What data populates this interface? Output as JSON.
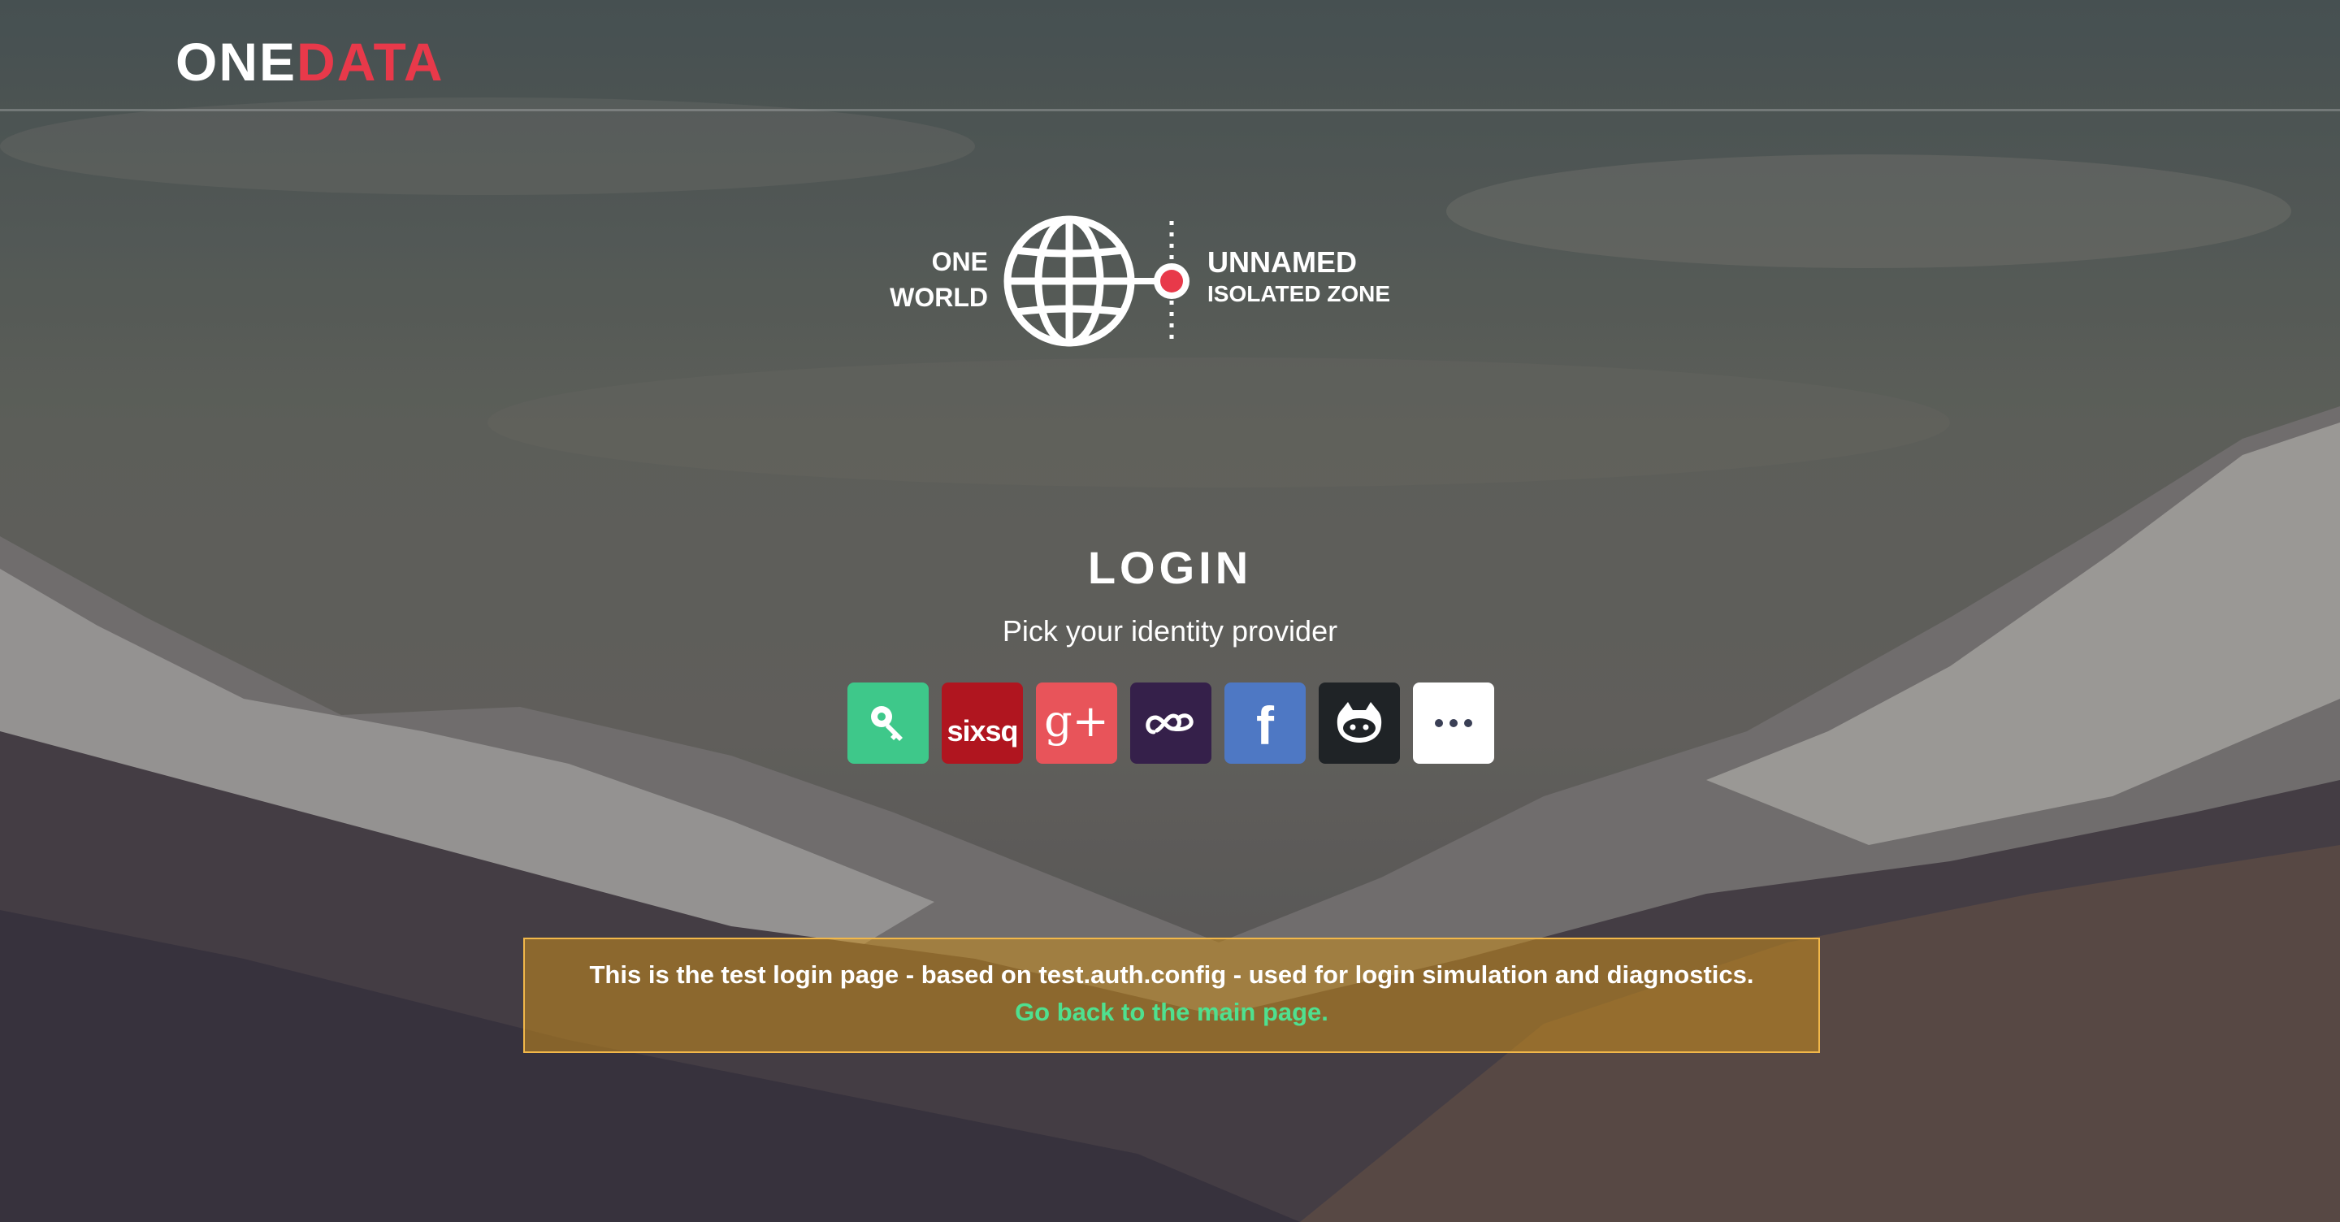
{
  "brand": {
    "prefix": "ONE",
    "accent": "DATA"
  },
  "emblem": {
    "left_line1": "ONE",
    "left_line2": "WORLD",
    "zone_name": "UNNAMED",
    "zone_type": "ISOLATED ZONE"
  },
  "login": {
    "title": "LOGIN",
    "subtitle": "Pick your identity provider"
  },
  "providers": [
    {
      "name": "basic-auth",
      "icon": "key-icon",
      "color": "#3ec88a"
    },
    {
      "name": "sixsq",
      "label": "sixsq",
      "color": "#b0151f"
    },
    {
      "name": "google",
      "label": "g+",
      "color": "#e8545a"
    },
    {
      "name": "elixir",
      "icon": "infinity-cloud-icon",
      "color": "#35204a"
    },
    {
      "name": "facebook",
      "label": "f",
      "color": "#4e78c4"
    },
    {
      "name": "github",
      "icon": "github-octocat-icon",
      "color": "#1f2326"
    },
    {
      "name": "more",
      "icon": "ellipsis-icon",
      "color": "#ffffff"
    }
  ],
  "notice": {
    "message": "This is the test login page - based on test.auth.config - used for login simulation and diagnostics.",
    "link": "Go back to the main page."
  },
  "colors": {
    "accent": "#e8394a",
    "link": "#4fe08f",
    "notice_border": "#f2b84a"
  }
}
